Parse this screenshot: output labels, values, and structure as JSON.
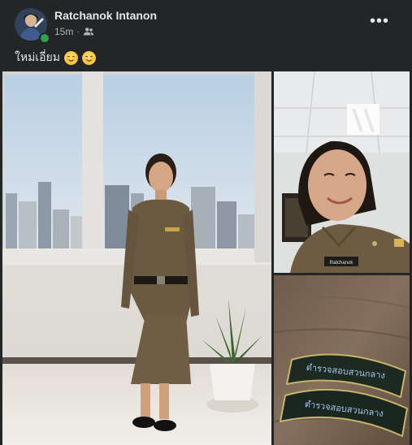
{
  "post": {
    "author": "Ratchanok Intanon",
    "time": "15m",
    "separator": "·",
    "audience_icon": "friends-icon",
    "more_icon": "more-dots-icon",
    "more_symbol": "•••",
    "caption_text": "ใหม่เอี่ยม",
    "caption_emojis": [
      "smiling-face-icon",
      "smiling-face-icon"
    ]
  },
  "photos": {
    "count": 3,
    "patch_text": "ตำรวจสอบสวนกลาง",
    "name_tag": "Ratchanok"
  },
  "colors": {
    "background": "#242526",
    "primary_text": "#e4e6eb",
    "secondary_text": "#b0b3b8",
    "online": "#31a24c",
    "uniform": "#6b5a42"
  }
}
